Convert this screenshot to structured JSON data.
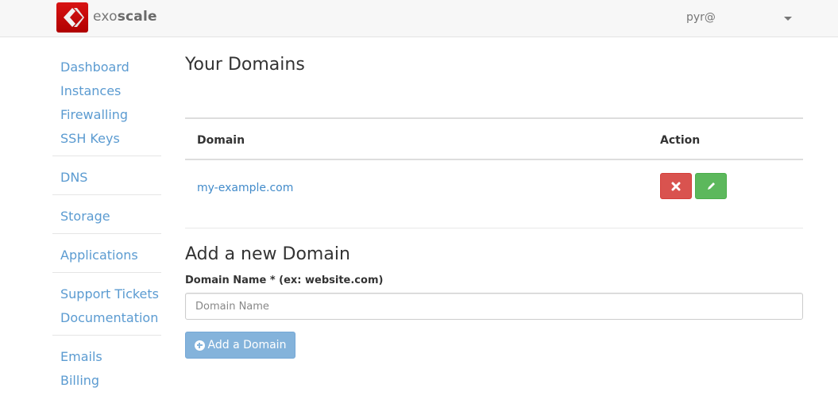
{
  "navbar": {
    "brand_light": "exo",
    "brand_bold": "scale",
    "user": "pyr@",
    "logo_color": "#c40a0a"
  },
  "sidebar": {
    "groups": [
      [
        {
          "label": "Dashboard"
        },
        {
          "label": "Instances"
        },
        {
          "label": "Firewalling"
        },
        {
          "label": "SSH Keys"
        }
      ],
      [
        {
          "label": "DNS"
        }
      ],
      [
        {
          "label": "Storage"
        }
      ],
      [
        {
          "label": "Applications"
        }
      ],
      [
        {
          "label": "Support Tickets"
        },
        {
          "label": "Documentation"
        }
      ],
      [
        {
          "label": "Emails"
        },
        {
          "label": "Billing"
        }
      ]
    ]
  },
  "main": {
    "title": "Your Domains",
    "table": {
      "columns": [
        "Domain",
        "Action"
      ],
      "rows": [
        {
          "domain": "my-example.com",
          "actions": [
            "delete-icon",
            "edit-icon"
          ]
        }
      ]
    },
    "add_form": {
      "title": "Add a new Domain",
      "label": "Domain Name * (ex: website.com)",
      "placeholder": "Domain Name",
      "value": "",
      "button": "Add a Domain"
    }
  },
  "colors": {
    "link": "#5b9bd1",
    "danger": "#d9534f",
    "success": "#5cb85c",
    "primary_disabled": "#84b3db"
  }
}
